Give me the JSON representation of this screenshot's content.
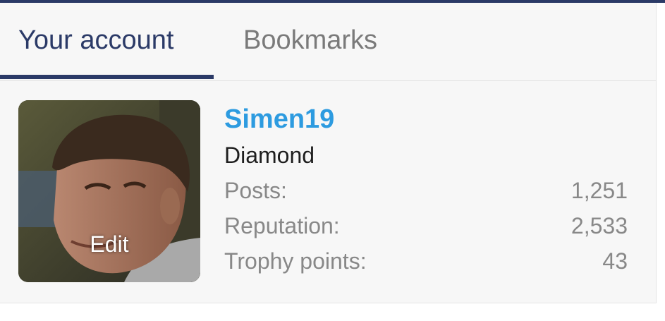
{
  "tabs": {
    "account": "Your account",
    "bookmarks": "Bookmarks",
    "active": "account"
  },
  "profile": {
    "avatar_edit_label": "Edit",
    "username": "Simen19",
    "title": "Diamond",
    "stats": [
      {
        "label": "Posts:",
        "value": "1,251"
      },
      {
        "label": "Reputation:",
        "value": "2,533"
      },
      {
        "label": "Trophy points:",
        "value": "43"
      }
    ]
  },
  "colors": {
    "accent": "#2b3a67",
    "username": "#2d9be0",
    "muted_text": "#888888",
    "panel_bg": "#f7f7f7"
  }
}
